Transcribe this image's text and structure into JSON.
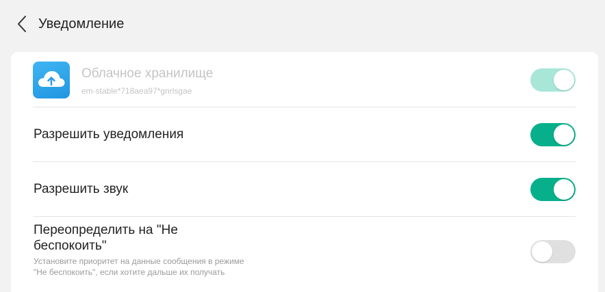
{
  "header": {
    "title": "Уведомление"
  },
  "app": {
    "name": "Облачное хранилище",
    "id": "em-stable*718aea97*gnrlsgae",
    "icon": "cloud-upload-icon",
    "enabled": true,
    "disabled_state": true
  },
  "settings": {
    "allow_notifications": {
      "label": "Разрешить уведомления",
      "on": true
    },
    "allow_sound": {
      "label": "Разрешить звук",
      "on": true
    },
    "override_dnd": {
      "label": "Переопределить на \"Не беспокоить\"",
      "description": "Установите приоритет на данные сообщения в режиме \"Не беспокоить\", если хотите дальше их получать",
      "on": false
    }
  },
  "colors": {
    "toggle_on": "#07b08a",
    "toggle_on_disabled": "#a8e6d8",
    "toggle_off": "#e0e0e0",
    "icon_bg": "#2a9de8"
  }
}
